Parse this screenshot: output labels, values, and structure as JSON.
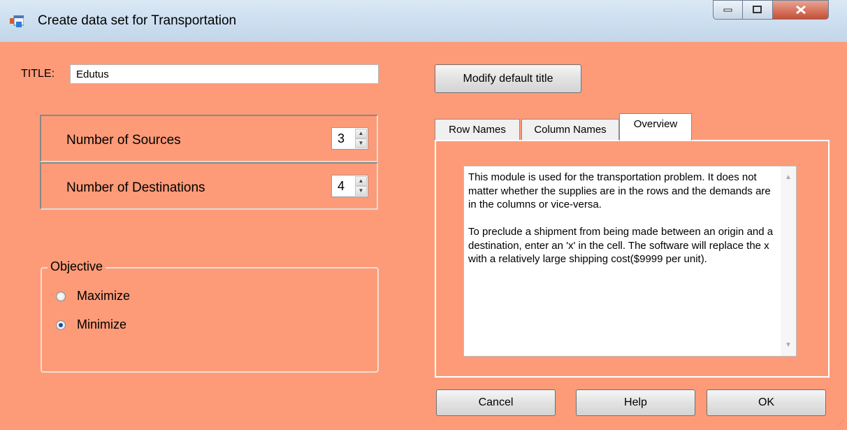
{
  "window": {
    "title": "Create data set for Transportation",
    "buttons": {
      "minimize": "minimize-icon",
      "maximize": "maximize-icon",
      "close": "close-icon"
    }
  },
  "form": {
    "title_label": "TITLE:",
    "title_value": "Edutus",
    "modify_title_button": "Modify default title",
    "sources": {
      "label": "Number of Sources",
      "value": "3"
    },
    "destinations": {
      "label": "Number of Destinations",
      "value": "4"
    },
    "objective": {
      "legend": "Objective",
      "options": [
        {
          "label": "Maximize",
          "selected": false
        },
        {
          "label": "Minimize",
          "selected": true
        }
      ]
    }
  },
  "tabs": {
    "items": [
      "Row Names",
      "Column Names",
      "Overview"
    ],
    "active": "Overview",
    "overview_text": "This module is used for the transportation problem. It does not matter whether the supplies are in the rows and the demands are in the columns or vice-versa.\n\nTo preclude a shipment from being made between an origin and a destination, enter an 'x' in the cell. The software will replace the x with a relatively large shipping cost($9999 per unit)."
  },
  "footer": {
    "cancel": "Cancel",
    "help": "Help",
    "ok": "OK"
  },
  "colors": {
    "background": "#fd9b78",
    "titlebar": "#cddff0",
    "close": "#c74f35"
  }
}
